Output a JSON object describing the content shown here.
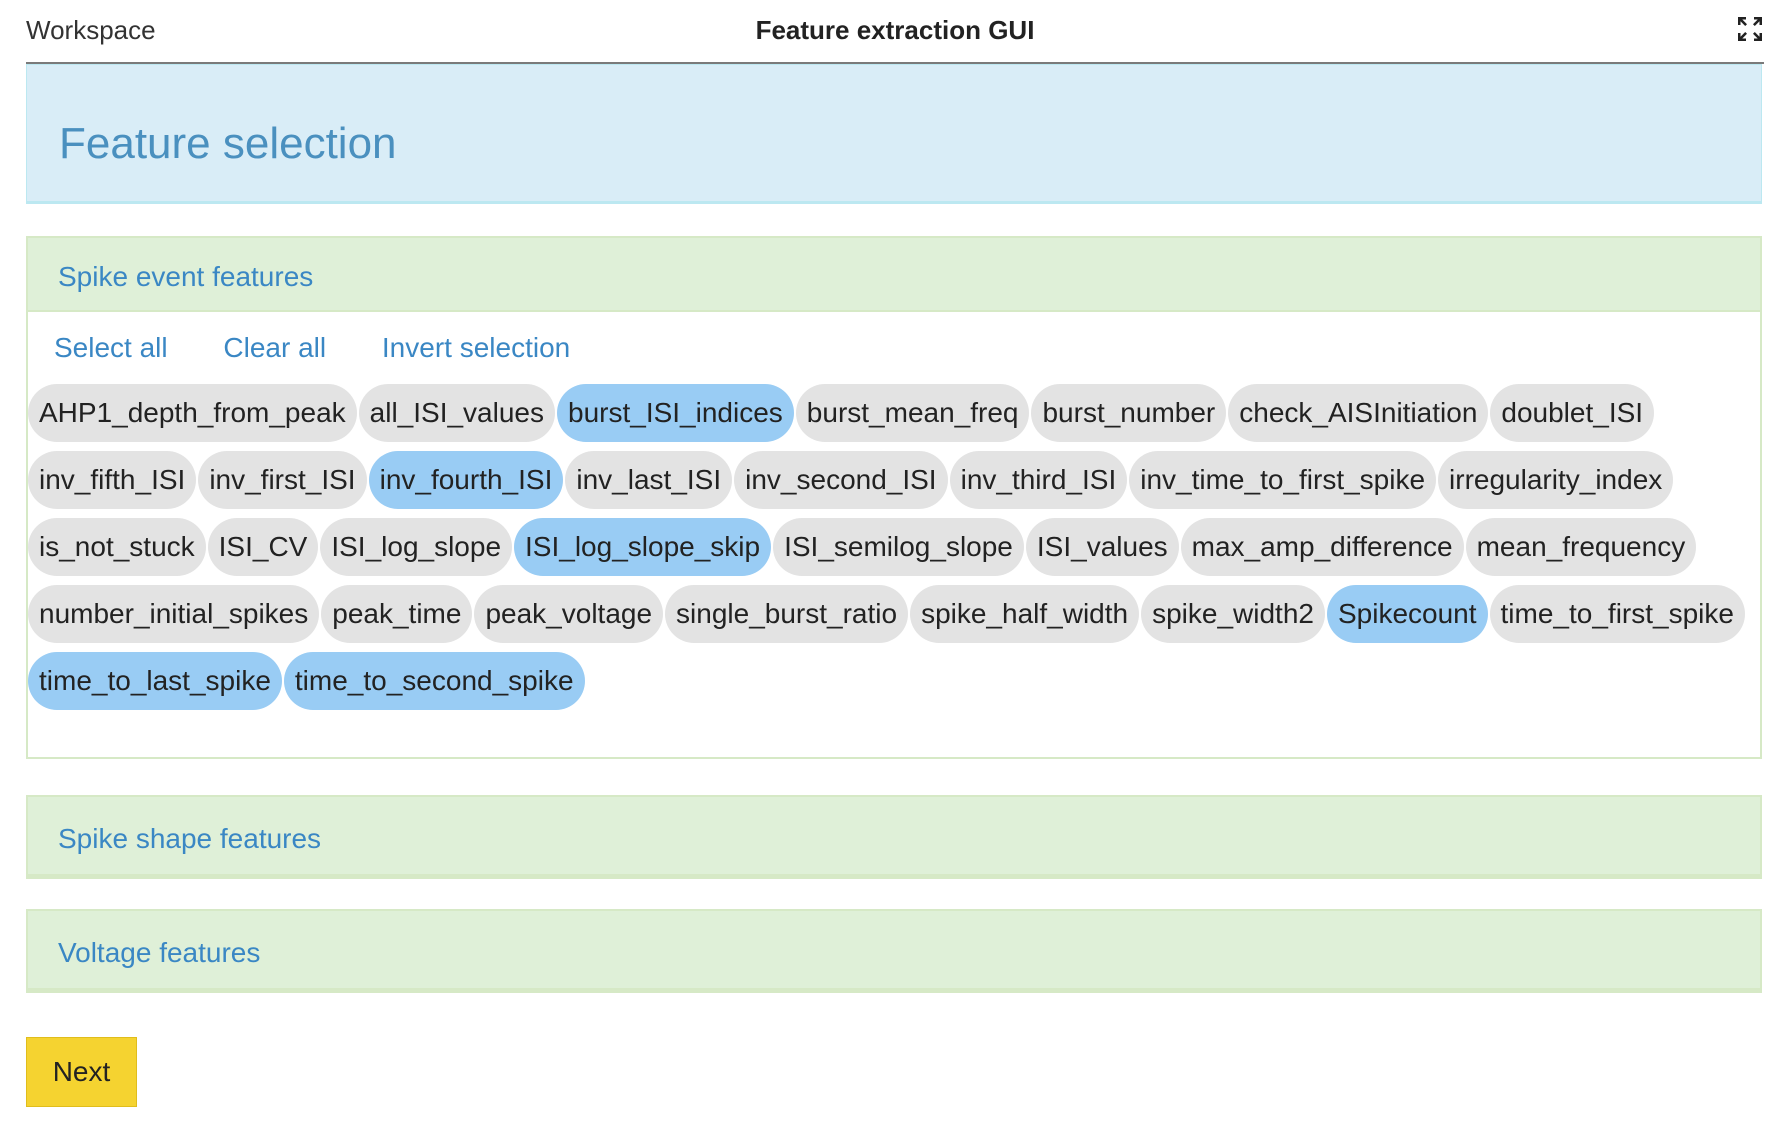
{
  "topbar": {
    "workspace_label": "Workspace",
    "title": "Feature extraction GUI",
    "fullscreen_icon": "fullscreen-icon"
  },
  "header": {
    "title": "Feature selection"
  },
  "sections": {
    "spike_event": {
      "title": "Spike event features",
      "actions": {
        "select_all": "Select all",
        "clear_all": "Clear all",
        "invert": "Invert selection"
      },
      "features": [
        {
          "label": "AHP1_depth_from_peak",
          "selected": false
        },
        {
          "label": "all_ISI_values",
          "selected": false
        },
        {
          "label": "burst_ISI_indices",
          "selected": true
        },
        {
          "label": "burst_mean_freq",
          "selected": false
        },
        {
          "label": "burst_number",
          "selected": false
        },
        {
          "label": "check_AISInitiation",
          "selected": false
        },
        {
          "label": "doublet_ISI",
          "selected": false
        },
        {
          "label": "inv_fifth_ISI",
          "selected": false
        },
        {
          "label": "inv_first_ISI",
          "selected": false
        },
        {
          "label": "inv_fourth_ISI",
          "selected": true
        },
        {
          "label": "inv_last_ISI",
          "selected": false
        },
        {
          "label": "inv_second_ISI",
          "selected": false
        },
        {
          "label": "inv_third_ISI",
          "selected": false
        },
        {
          "label": "inv_time_to_first_spike",
          "selected": false
        },
        {
          "label": "irregularity_index",
          "selected": false
        },
        {
          "label": "is_not_stuck",
          "selected": false
        },
        {
          "label": "ISI_CV",
          "selected": false
        },
        {
          "label": "ISI_log_slope",
          "selected": false
        },
        {
          "label": "ISI_log_slope_skip",
          "selected": true
        },
        {
          "label": "ISI_semilog_slope",
          "selected": false
        },
        {
          "label": "ISI_values",
          "selected": false
        },
        {
          "label": "max_amp_difference",
          "selected": false
        },
        {
          "label": "mean_frequency",
          "selected": false
        },
        {
          "label": "number_initial_spikes",
          "selected": false
        },
        {
          "label": "peak_time",
          "selected": false
        },
        {
          "label": "peak_voltage",
          "selected": false
        },
        {
          "label": "single_burst_ratio",
          "selected": false
        },
        {
          "label": "spike_half_width",
          "selected": false
        },
        {
          "label": "spike_width2",
          "selected": false
        },
        {
          "label": "Spikecount",
          "selected": true
        },
        {
          "label": "time_to_first_spike",
          "selected": false
        },
        {
          "label": "time_to_last_spike",
          "selected": true
        },
        {
          "label": "time_to_second_spike",
          "selected": true
        }
      ]
    },
    "spike_shape": {
      "title": "Spike shape features"
    },
    "voltage": {
      "title": "Voltage features"
    }
  },
  "next_label": "Next",
  "colors": {
    "selected_chip": "#99ccf4",
    "chip": "#e3e3e3",
    "link": "#3a87c4",
    "next_button": "#f5d330"
  }
}
